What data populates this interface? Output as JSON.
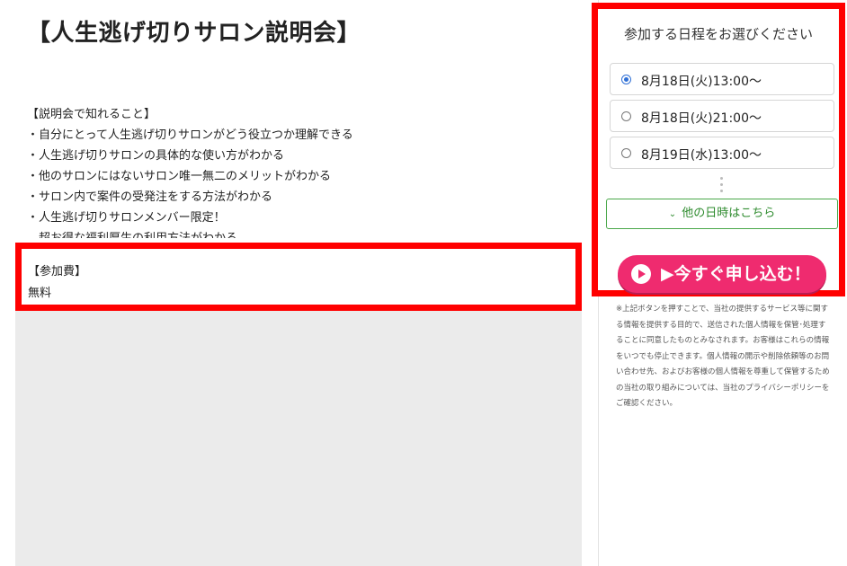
{
  "main": {
    "title": "【人生逃げ切りサロン説明会】",
    "learn": {
      "heading": "【説明会で知れること】",
      "items": [
        "・自分にとって人生逃げ切りサロンがどう役立つか理解できる",
        "・人生逃げ切りサロンの具体的な使い方がわかる",
        "・他のサロンにはないサロン唯一無二のメリットがわかる",
        "・サロン内で案件の受発注をする方法がわかる",
        "・人生逃げ切りサロンメンバー限定！",
        "　超お得な福利厚生の利用方法がわかる"
      ]
    },
    "fee": {
      "label": "【参加費】",
      "value": "無料"
    }
  },
  "sidebar": {
    "schedule_title": "参加する日程をお選びください",
    "options": [
      {
        "label": "8月18日(火)13:00〜",
        "selected": true
      },
      {
        "label": "8月18日(火)21:00〜",
        "selected": false
      },
      {
        "label": "8月19日(水)13:00〜",
        "selected": false
      }
    ],
    "other_dates_label": "他の日時はこちら",
    "apply_label": "▶今すぐ申し込む！",
    "notice": "※上記ボタンを押すことで、当社の提供するサービス等に関する情報を提供する目的で、送信された個人情報を保管･処理することに同意したものとみなされます。お客様はこれらの情報をいつでも停止できます。個人情報の開示や削除依頼等のお問い合わせ先、およびお客様の個人情報を尊重して保管するための当社の取り組みについては、当社のプライバシーポリシーをご確認ください。"
  },
  "colors": {
    "highlight": "#ff0000",
    "apply_button": "#ef2b6f",
    "other_dates": "#2e8b2e",
    "radio_selected": "#2f6fd6"
  }
}
